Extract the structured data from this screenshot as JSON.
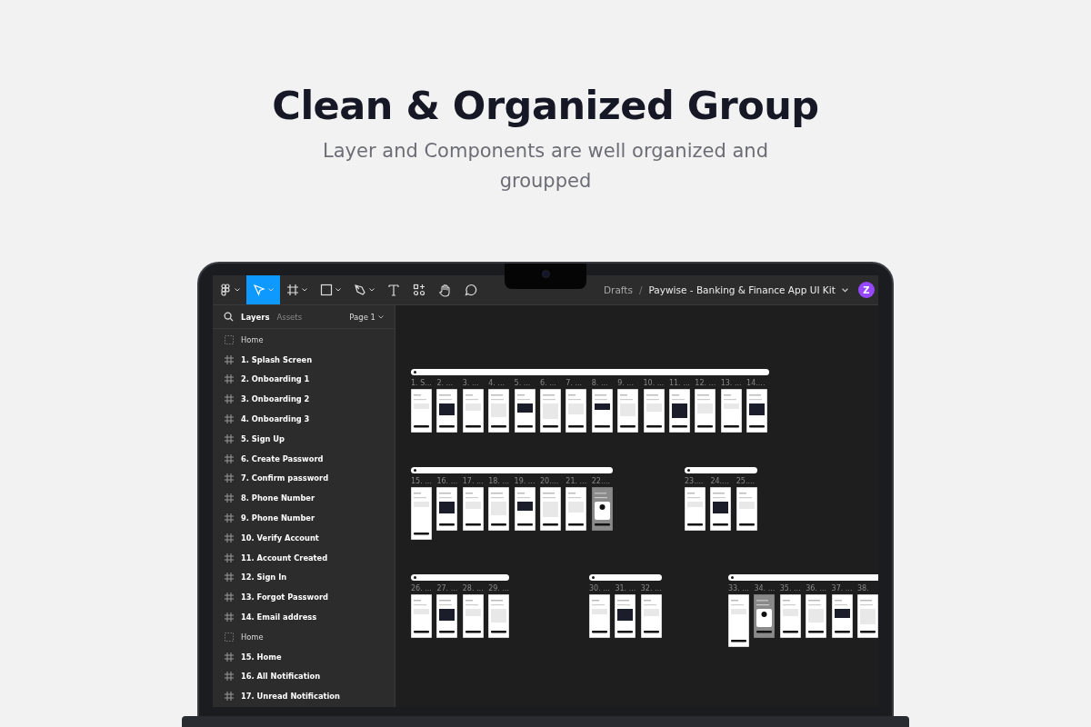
{
  "heading": "Clean & Organized Group",
  "subheading": "Layer and Components are well organized and groupped",
  "toolbar": {
    "tools": [
      {
        "kind": "menu",
        "selected": false
      },
      {
        "kind": "move",
        "selected": true
      },
      {
        "kind": "frame",
        "selected": false
      },
      {
        "kind": "shape",
        "selected": false
      },
      {
        "kind": "pen",
        "selected": false
      },
      {
        "kind": "text",
        "selected": false
      },
      {
        "kind": "resources",
        "selected": false
      },
      {
        "kind": "hand",
        "selected": false
      },
      {
        "kind": "comment",
        "selected": false
      }
    ],
    "breadcrumb": "Drafts",
    "separator": "/",
    "file_title": "Paywise - Banking & Finance App UI Kit",
    "avatar": "Z"
  },
  "panel": {
    "tabs": [
      {
        "label": "Layers",
        "selected": true
      },
      {
        "label": "Assets",
        "selected": false
      }
    ],
    "page": "Page 1",
    "layers": [
      {
        "kind": "section",
        "label": "Home"
      },
      {
        "kind": "frame",
        "label": "1. Splash Screen"
      },
      {
        "kind": "frame",
        "label": "2. Onboarding 1"
      },
      {
        "kind": "frame",
        "label": "3. Onboarding 2"
      },
      {
        "kind": "frame",
        "label": "4. Onboarding 3"
      },
      {
        "kind": "frame",
        "label": "5. Sign Up"
      },
      {
        "kind": "frame",
        "label": "6. Create Password"
      },
      {
        "kind": "frame",
        "label": "7. Confirm password"
      },
      {
        "kind": "frame",
        "label": "8. Phone Number"
      },
      {
        "kind": "frame",
        "label": "9. Phone Number"
      },
      {
        "kind": "frame",
        "label": "10. Verify Account"
      },
      {
        "kind": "frame",
        "label": "11. Account Created"
      },
      {
        "kind": "frame",
        "label": "12. Sign In"
      },
      {
        "kind": "frame",
        "label": "13. Forgot Password"
      },
      {
        "kind": "frame",
        "label": "14. Email address"
      },
      {
        "kind": "section",
        "label": "Home"
      },
      {
        "kind": "frame",
        "label": "15. Home"
      },
      {
        "kind": "frame",
        "label": "16. All Notification"
      },
      {
        "kind": "frame",
        "label": "17. Unread Notification"
      }
    ]
  },
  "canvas": {
    "groups": [
      {
        "frames": [
          {
            "label": "1. S...",
            "tall": false,
            "dimmed": false
          },
          {
            "label": "2. ...",
            "tall": false,
            "dimmed": false
          },
          {
            "label": "3. ...",
            "tall": false,
            "dimmed": false
          },
          {
            "label": "4. ...",
            "tall": false,
            "dimmed": false
          },
          {
            "label": "5. ...",
            "tall": false,
            "dimmed": false
          },
          {
            "label": "6. ...",
            "tall": false,
            "dimmed": false
          },
          {
            "label": "7. ...",
            "tall": false,
            "dimmed": false
          },
          {
            "label": "8. ...",
            "tall": false,
            "dimmed": false
          },
          {
            "label": "9. ...",
            "tall": false,
            "dimmed": false
          },
          {
            "label": "10. ...",
            "tall": false,
            "dimmed": false
          },
          {
            "label": "11. ...",
            "tall": false,
            "dimmed": false
          },
          {
            "label": "12. ...",
            "tall": false,
            "dimmed": false
          },
          {
            "label": "13. ...",
            "tall": false,
            "dimmed": false
          },
          {
            "label": "14....",
            "tall": false,
            "dimmed": false
          }
        ]
      },
      {
        "frames": [
          {
            "label": "15. ...",
            "tall": true,
            "dimmed": false
          },
          {
            "label": "16. ...",
            "tall": false,
            "dimmed": false
          },
          {
            "label": "17. ...",
            "tall": false,
            "dimmed": false
          },
          {
            "label": "18. ...",
            "tall": false,
            "dimmed": false
          },
          {
            "label": "19. ...",
            "tall": false,
            "dimmed": false
          },
          {
            "label": "20....",
            "tall": false,
            "dimmed": false
          },
          {
            "label": "21. ...",
            "tall": false,
            "dimmed": false
          },
          {
            "label": "22....",
            "tall": false,
            "dimmed": true
          }
        ]
      },
      {
        "frames": [
          {
            "label": "23....",
            "tall": false,
            "dimmed": false
          },
          {
            "label": "24....",
            "tall": false,
            "dimmed": false
          },
          {
            "label": "25....",
            "tall": false,
            "dimmed": false
          }
        ]
      },
      {
        "frames": [
          {
            "label": "26. ...",
            "tall": false,
            "dimmed": false
          },
          {
            "label": "27. ...",
            "tall": false,
            "dimmed": false
          },
          {
            "label": "28. ...",
            "tall": false,
            "dimmed": false
          },
          {
            "label": "29. ...",
            "tall": false,
            "dimmed": false
          }
        ]
      },
      {
        "frames": [
          {
            "label": "30. ...",
            "tall": false,
            "dimmed": false
          },
          {
            "label": "31. ...",
            "tall": false,
            "dimmed": false
          },
          {
            "label": "32. ...",
            "tall": false,
            "dimmed": false
          }
        ]
      },
      {
        "frames": [
          {
            "label": "33. ...",
            "tall": true,
            "dimmed": false
          },
          {
            "label": "34. ...",
            "tall": false,
            "dimmed": true
          },
          {
            "label": "35. ...",
            "tall": false,
            "dimmed": false
          },
          {
            "label": "36. ...",
            "tall": false,
            "dimmed": false
          },
          {
            "label": "37. ...",
            "tall": false,
            "dimmed": false
          },
          {
            "label": "38.",
            "tall": false,
            "dimmed": false
          }
        ]
      }
    ]
  }
}
